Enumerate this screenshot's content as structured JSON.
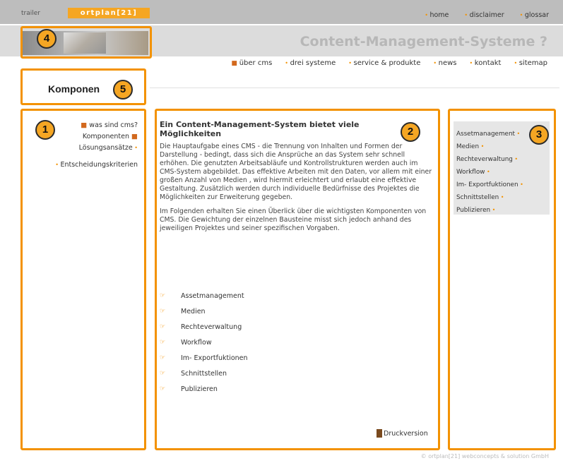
{
  "topbar": {
    "trailer": "trailer",
    "logo": "ortplan[21]",
    "nav": [
      "home",
      "disclaimer",
      "glossar"
    ]
  },
  "header": {
    "title": "Content-Management-Systeme ?"
  },
  "subnav": [
    "über cms",
    "drei systeme",
    "service & produkte",
    "news",
    "kontakt",
    "sitemap"
  ],
  "section_title": "Komponen",
  "badges": [
    "1",
    "2",
    "3",
    "4",
    "5"
  ],
  "leftnav": {
    "items": [
      "was sind cms?",
      "Komponenten",
      "Lösungsansätze",
      "Entscheidungskriterien"
    ]
  },
  "main": {
    "heading": "Ein Content-Management-System bietet viele Möglichkeiten",
    "para1": "Die Hauptaufgabe eines CMS - die Trennung von Inhalten und Formen der Darstellung - bedingt, dass sich die Ansprüche an das System sehr schnell erhöhen. Die genutzten Arbeitsabläufe und Kontrollstrukturen werden auch im CMS-System abgebildet. Das effektive Arbeiten mit den Daten, vor allem mit einer großen Anzahl von Medien , wird hiermit erleichtert und erlaubt eine effektive Gestaltung. Zusätzlich werden durch individuelle Bedürfnisse des Projektes die Möglichkeiten zur Erweiterung gegeben.",
    "para2": "Im Folgenden erhalten Sie einen Überlick über die wichtigsten Komponenten von CMS. Die Gewichtung der einzelnen Bausteine misst sich jedoch anhand des jeweiligen Projektes und seiner spezifischen Vorgaben.",
    "list": [
      "Assetmanagement",
      "Medien",
      "Rechteverwaltung",
      "Workflow",
      "Im- Exportfuktionen",
      "Schnittstellen",
      "Publizieren"
    ],
    "print_label": "Druckversion"
  },
  "rightnav": {
    "items": [
      "Assetmanagement",
      "Medien",
      "Rechteverwaltung",
      "Workflow",
      "Im- Exportfuktionen",
      "Schnittstellen",
      "Publizieren"
    ]
  },
  "footer": "© ortplan[21] webconcepts & solution GmbH",
  "colors": {
    "accent": "#f39200",
    "topbar": "#bdbdbd",
    "header": "#dcdcdc"
  }
}
